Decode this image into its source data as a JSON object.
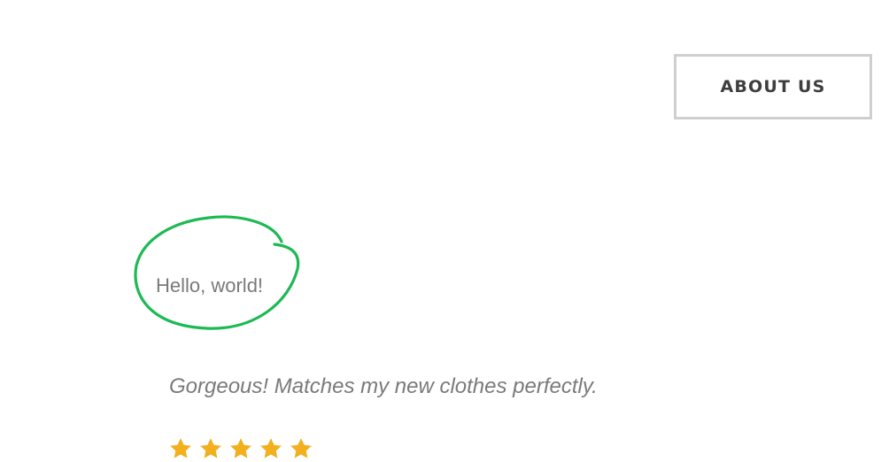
{
  "header": {
    "about_label": "ABOUT US"
  },
  "hero": {
    "circled_text": "Hello, world!",
    "circle_color": "#1db954"
  },
  "review": {
    "quote": "Gorgeous! Matches my new clothes perfectly.",
    "rating": 5,
    "rating_max": 5,
    "star_icon": "star-icon",
    "star_color": "#f2b01e"
  }
}
